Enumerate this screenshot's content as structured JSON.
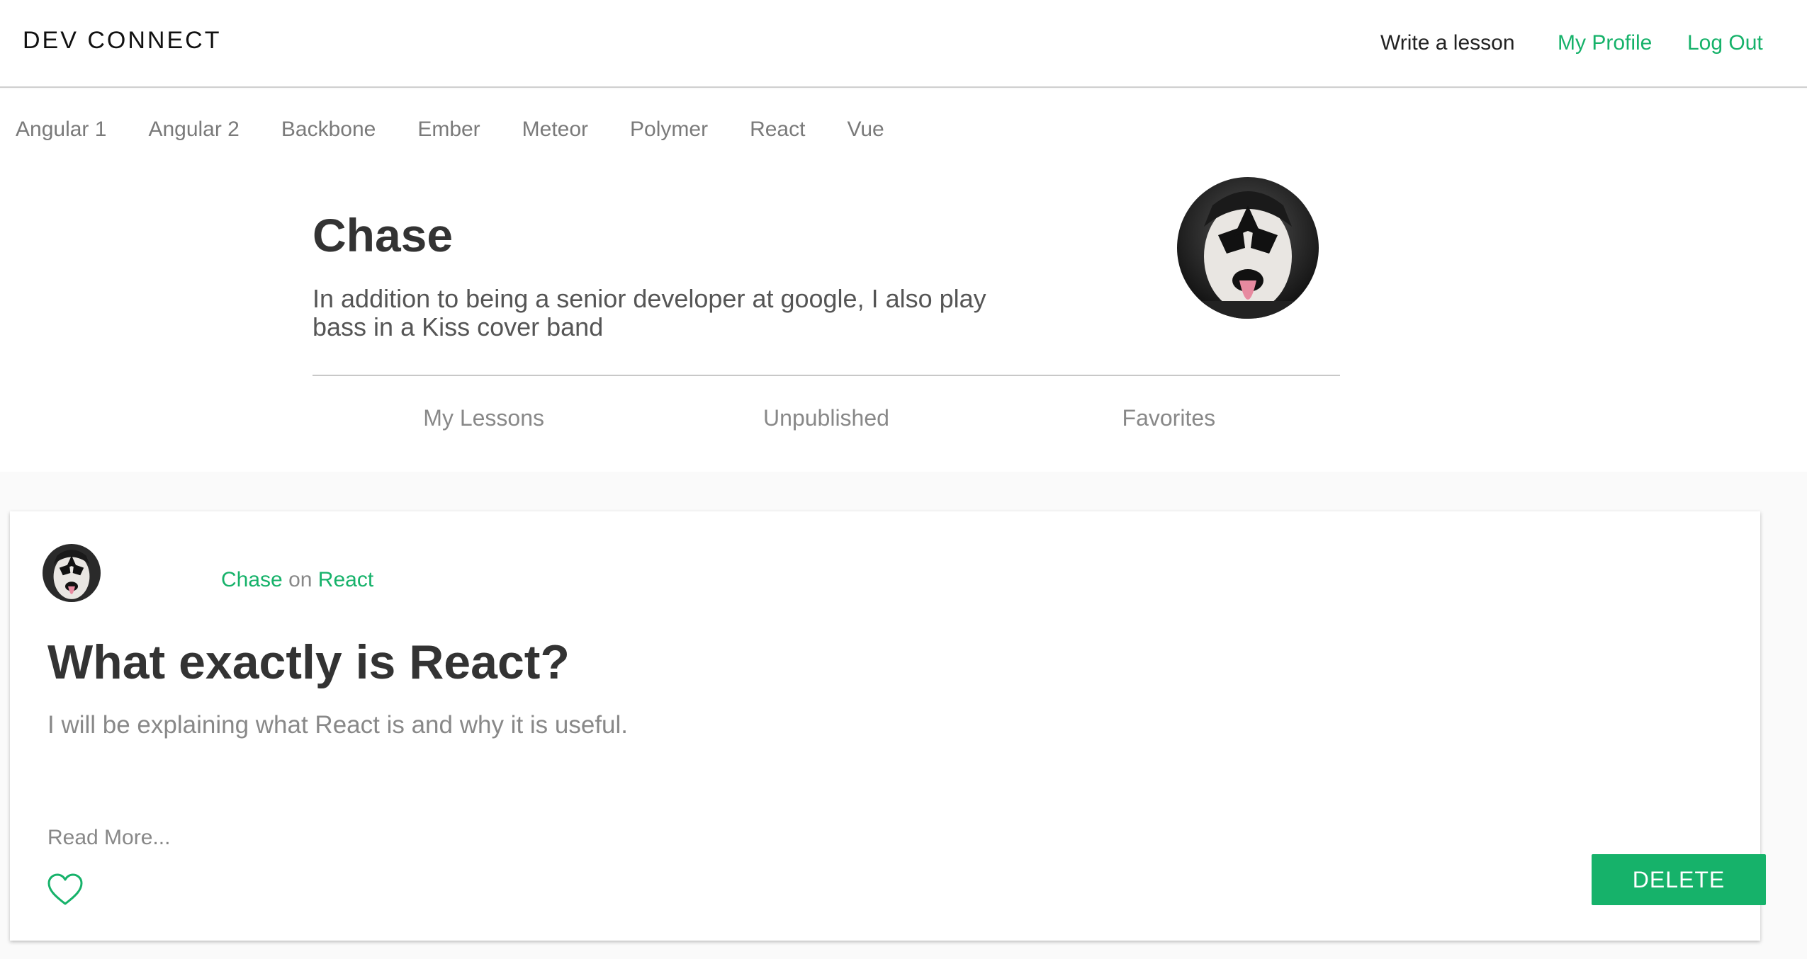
{
  "header": {
    "brand": "DEV CONNECT",
    "write_lesson": "Write a lesson",
    "my_profile": "My Profile",
    "log_out": "Log Out",
    "accent_color": "#16b26a"
  },
  "topics": [
    "Angular 1",
    "Angular 2",
    "Backbone",
    "Ember",
    "Meteor",
    "Polymer",
    "React",
    "Vue"
  ],
  "profile": {
    "name": "Chase",
    "bio": "In addition to being a senior developer at google, I also play bass in a Kiss cover band",
    "avatar_icon": "face-paint-avatar",
    "tabs": [
      "My Lessons",
      "Unpublished",
      "Favorites"
    ]
  },
  "lesson": {
    "author": "Chase",
    "on": "on",
    "topic": "React",
    "title": "What exactly is React?",
    "description": "I will be explaining what React is and why it is useful.",
    "read_more": "Read More...",
    "favorite_icon": "heart-outline-icon",
    "delete_label": "DELETE"
  }
}
